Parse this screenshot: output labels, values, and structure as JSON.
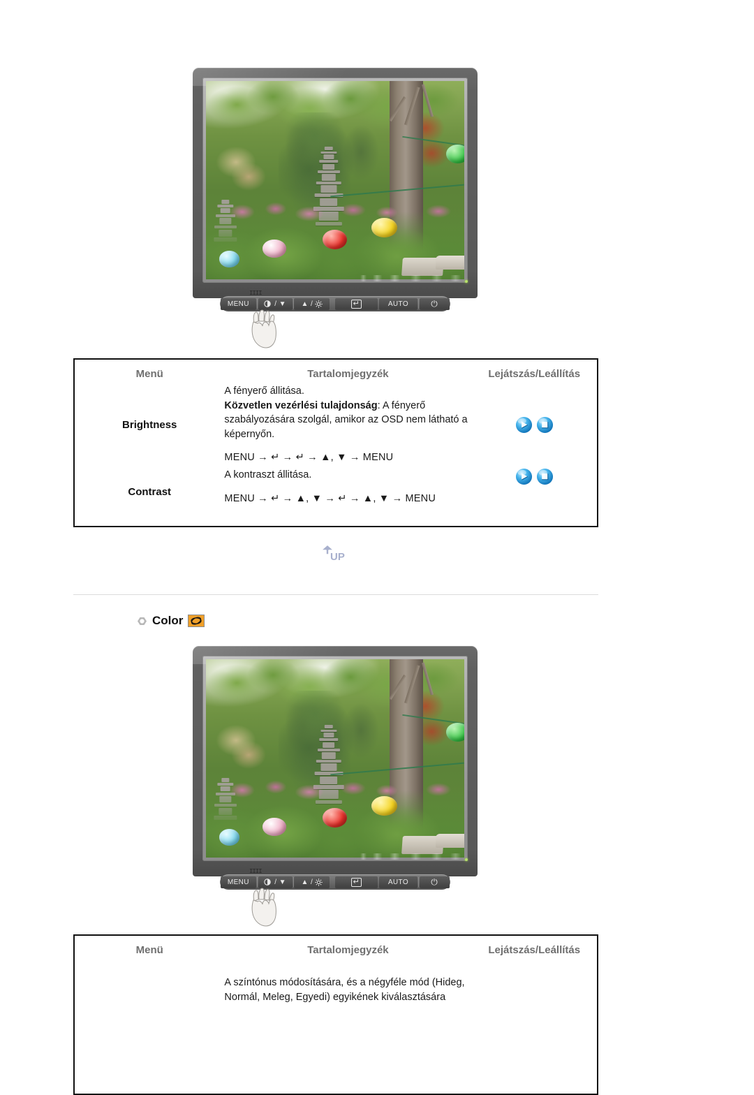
{
  "monitors": [
    {
      "name": "brightness-monitor",
      "alt": "LCD monitor displaying a Korean garden scene with a stone pagoda and paper lanterns",
      "controls": {
        "menu_label": "MENU",
        "down_label": "/ ▼",
        "up_label": "▲ /",
        "enter_label": "↵",
        "auto_label": "AUTO",
        "power_label": "⏻"
      }
    },
    {
      "name": "color-monitor",
      "alt": "LCD monitor displaying a Korean garden scene with a stone pagoda and paper lanterns",
      "controls": {
        "menu_label": "MENU",
        "down_label": "/ ▼",
        "up_label": "▲ /",
        "enter_label": "↵",
        "auto_label": "AUTO",
        "power_label": "⏻"
      }
    }
  ],
  "table_headers": {
    "menu": "Menü",
    "contents": "Tartalomjegyzék",
    "play_stop": "Lejátszás/Leállítás"
  },
  "brightness_table": {
    "rows": [
      {
        "menu_label": "Brightness",
        "desc_line1": "A fényerő állitása.",
        "desc_bold": "Közvetlen vezérlési tulajdonság",
        "desc_rest": ": A fényerő szabályozására szolgál, amikor az OSD nem látható a képernyőn.",
        "sequence": "MENU → ↵ → ↵ → ▲, ▼ → MENU",
        "play_icon": "play-orb-icon",
        "stop_icon": "stop-orb-icon"
      },
      {
        "menu_label": "Contrast",
        "desc_line1": "A kontraszt állitása.",
        "desc_bold": "",
        "desc_rest": "",
        "sequence": "MENU → ↵ → ▲, ▼ → ↵ → ▲, ▼ → MENU",
        "play_icon": "play-orb-icon",
        "stop_icon": "stop-orb-icon"
      }
    ]
  },
  "up_button": {
    "label": "UP",
    "icon": "up-arrow-icon"
  },
  "color_section": {
    "bullet_icon": "hex-bullet-icon",
    "title": "Color",
    "chip_icon": "color-swatch-icon",
    "chip_color": "#f0a02a"
  },
  "color_table": {
    "rows": [
      {
        "menu_label": "",
        "desc_line1": "A színtónus módosítására, és a négyféle mód (Hideg,",
        "desc_line2": "Normál, Meleg, Egyedi) egyikének kiválasztására"
      }
    ]
  },
  "colors": {
    "header_text": "#6f6f6f",
    "body_text": "#1a1a1a",
    "table_border": "#111111",
    "divider": "#dcdcdc",
    "orb_blue": "#2aa7e8",
    "up_arrow": "#9aa4c4"
  }
}
